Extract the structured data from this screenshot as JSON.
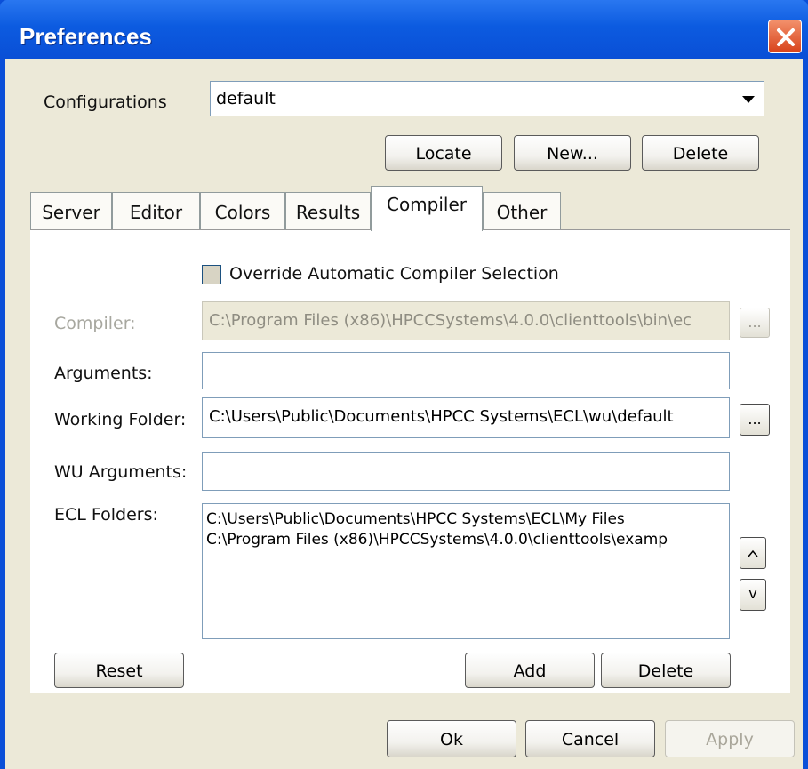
{
  "window": {
    "title": "Preferences"
  },
  "configurations": {
    "label": "Configurations",
    "selected": "default",
    "buttons": {
      "locate": "Locate",
      "new": "New...",
      "delete": "Delete"
    }
  },
  "tabs": [
    "Server",
    "Editor",
    "Colors",
    "Results",
    "Compiler",
    "Other"
  ],
  "active_tab": "Compiler",
  "compiler": {
    "override_label": "Override Automatic Compiler Selection",
    "override_checked": false,
    "compiler_label": "Compiler:",
    "compiler_value": "C:\\Program Files (x86)\\HPCCSystems\\4.0.0\\clienttools\\bin\\ec",
    "browse_label": "...",
    "arguments_label": "Arguments:",
    "arguments_value": "",
    "working_folder_label": "Working Folder:",
    "working_folder_value": "C:\\Users\\Public\\Documents\\HPCC Systems\\ECL\\wu\\default",
    "wu_arguments_label": "WU Arguments:",
    "wu_arguments_value": "",
    "ecl_folders_label": "ECL Folders:",
    "ecl_folders": [
      "C:\\Users\\Public\\Documents\\HPCC Systems\\ECL\\My Files",
      "C:\\Program Files (x86)\\HPCCSystems\\4.0.0\\clienttools\\examp"
    ],
    "up_label": "^",
    "down_label": "v",
    "reset_label": "Reset",
    "add_label": "Add",
    "delete_label": "Delete"
  },
  "dialog_buttons": {
    "ok": "Ok",
    "cancel": "Cancel",
    "apply": "Apply"
  },
  "colors": {
    "titlebar": "#0a4fd8",
    "dialog_bg": "#ece9d8",
    "close": "#d8431b"
  }
}
